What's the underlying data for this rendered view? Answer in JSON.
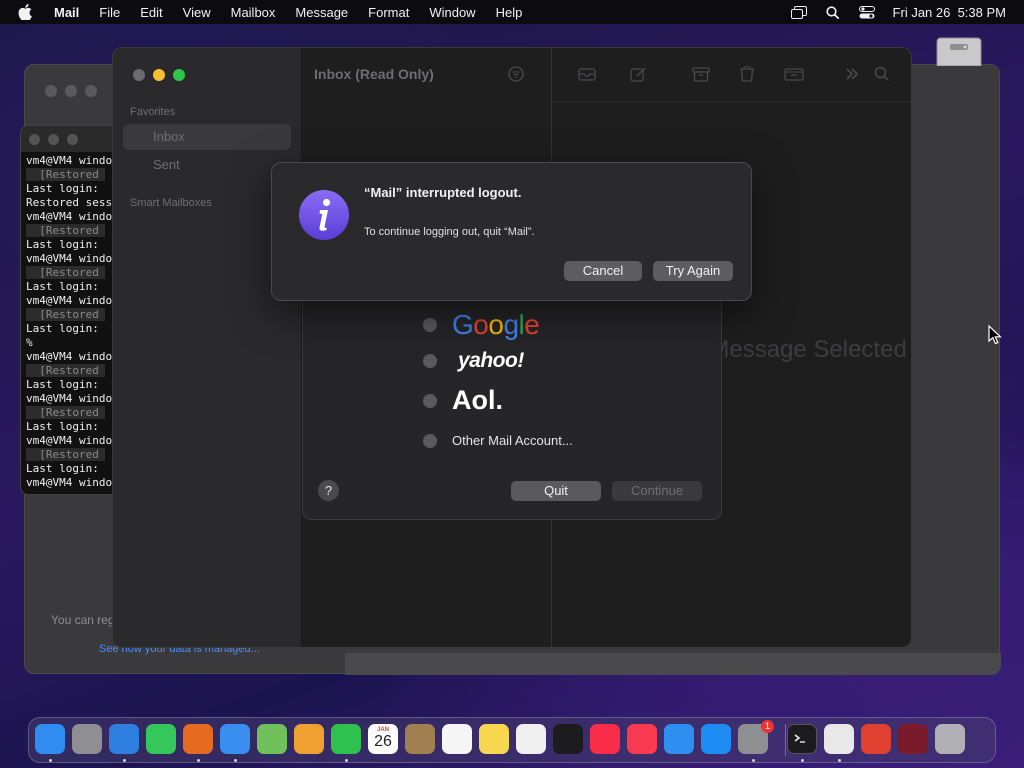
{
  "menubar": {
    "app": "Mail",
    "items": [
      "File",
      "Edit",
      "View",
      "Mailbox",
      "Message",
      "Format",
      "Window",
      "Help"
    ],
    "clock": "Fri Jan 26  5:38 PM"
  },
  "terminal": {
    "lines": [
      {
        "text": "vm4@VM4 windo",
        "dim": false
      },
      {
        "text": "  [Restored ",
        "dim": true
      },
      {
        "text": "Last login: ",
        "dim": false
      },
      {
        "text": "Restored sess",
        "dim": false
      },
      {
        "text": "vm4@VM4 windo",
        "dim": false
      },
      {
        "text": "  [Restored ",
        "dim": true
      },
      {
        "text": "Last login: ",
        "dim": false
      },
      {
        "text": "vm4@VM4 windo",
        "dim": false
      },
      {
        "text": "  [Restored ",
        "dim": true
      },
      {
        "text": "Last login: ",
        "dim": false
      },
      {
        "text": "vm4@VM4 windo",
        "dim": false
      },
      {
        "text": "  [Restored ",
        "dim": true
      },
      {
        "text": "Last login: ",
        "dim": false
      },
      {
        "text": "%",
        "dim": false
      },
      {
        "text": "vm4@VM4 windo",
        "dim": false
      },
      {
        "text": "  [Restored ",
        "dim": true
      },
      {
        "text": "Last login: ",
        "dim": false
      },
      {
        "text": "vm4@VM4 windo",
        "dim": false
      },
      {
        "text": "  [Restored ",
        "dim": true
      },
      {
        "text": "Last login: ",
        "dim": false
      },
      {
        "text": "vm4@VM4 windo",
        "dim": false
      },
      {
        "text": "  [Restored ",
        "dim": true
      },
      {
        "text": "Last login: ",
        "dim": false
      },
      {
        "text": "vm4@VM4 windo",
        "dim": false
      }
    ]
  },
  "back_window": {
    "footer_text": "You can reg",
    "footer_link": "See how your data is managed..."
  },
  "mail": {
    "sidebar": {
      "favorites_label": "Favorites",
      "inbox_label": "Inbox",
      "sent_label": "Sent",
      "smart_label": "Smart Mailboxes"
    },
    "list_title": "Inbox (Read Only)",
    "no_message": "No Message Selected"
  },
  "account_sheet": {
    "providers": [
      {
        "name": "Google"
      },
      {
        "name": "yahoo!"
      },
      {
        "name": "Aol."
      },
      {
        "name": "Other Mail Account..."
      }
    ],
    "help_label": "?",
    "quit_label": "Quit",
    "continue_label": "Continue"
  },
  "alert": {
    "title": "“Mail” interrupted logout.",
    "message": "To continue logging out, quit “Mail”.",
    "cancel_label": "Cancel",
    "try_again_label": "Try Again",
    "accent": "#6a4ce0"
  },
  "dock": {
    "items": [
      {
        "name": "finder",
        "color": "#2f8cf0",
        "running": true
      },
      {
        "name": "launchpad",
        "color": "#8e8e93",
        "running": false
      },
      {
        "name": "safari",
        "color": "#2f7fe0",
        "running": true
      },
      {
        "name": "messages",
        "color": "#34c759",
        "running": false
      },
      {
        "name": "firefox",
        "color": "#e66a1f",
        "running": true
      },
      {
        "name": "mail",
        "color": "#3a8ef0",
        "running": true
      },
      {
        "name": "maps",
        "color": "#6fbf5a",
        "running": false
      },
      {
        "name": "photos",
        "color": "#f0a030",
        "running": false
      },
      {
        "name": "facetime",
        "color": "#30c050",
        "running": true
      },
      {
        "name": "calendar",
        "color": "#ffffff",
        "running": false
      },
      {
        "name": "contacts",
        "color": "#a08050",
        "running": false
      },
      {
        "name": "reminders",
        "color": "#f5f5f5",
        "running": false
      },
      {
        "name": "notes",
        "color": "#f8d650",
        "running": false
      },
      {
        "name": "freeform",
        "color": "#f0f0f0",
        "running": false
      },
      {
        "name": "appletv",
        "color": "#1c1c1e",
        "running": false
      },
      {
        "name": "music",
        "color": "#fa2d48",
        "running": false
      },
      {
        "name": "news",
        "color": "#f83a50",
        "running": false
      },
      {
        "name": "keynote",
        "color": "#2f8ff0",
        "running": false
      },
      {
        "name": "appstore",
        "color": "#1e8cf5",
        "running": false
      },
      {
        "name": "system-settings",
        "color": "#8e8e93",
        "running": true
      },
      {
        "name": "terminal",
        "color": "#1c1c1e",
        "running": true
      },
      {
        "name": "chrome",
        "color": "#e8e8e8",
        "running": true
      },
      {
        "name": "compass",
        "color": "#e04030",
        "running": false
      },
      {
        "name": "wine",
        "color": "#7a1a2a",
        "running": false
      },
      {
        "name": "trash",
        "color": "#b0b0b5",
        "running": false
      }
    ],
    "calendar": {
      "month": "JAN",
      "day": "26"
    },
    "settings_badge": "1"
  }
}
